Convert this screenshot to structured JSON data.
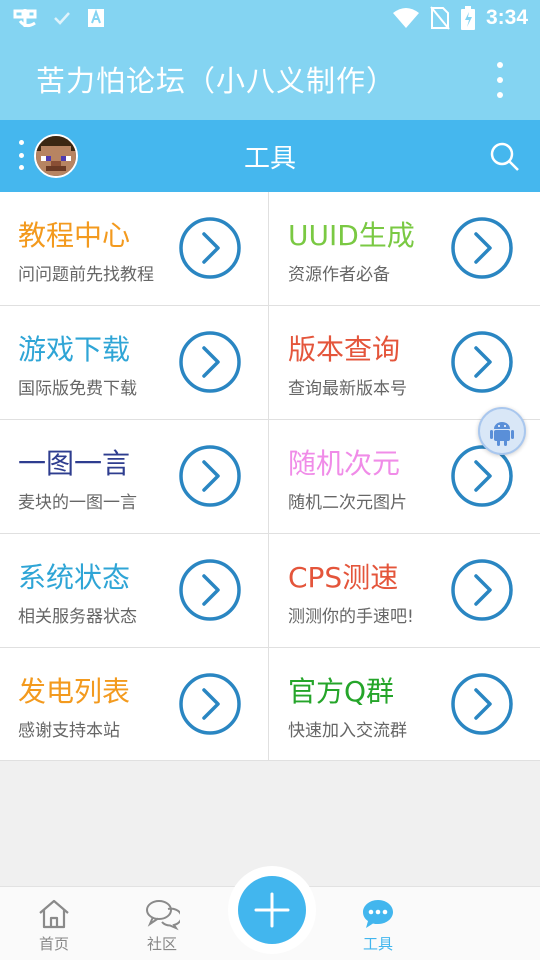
{
  "status_bar": {
    "time": "3:34",
    "icons": [
      "app-notification-icon",
      "check-icon",
      "text-icon",
      "wifi-icon",
      "no-sim-icon",
      "battery-charging-icon"
    ]
  },
  "app_bar": {
    "title": "苦力怕论坛（小八义制作）"
  },
  "tool_bar": {
    "title": "工具"
  },
  "tools": [
    {
      "title": "教程中心",
      "subtitle": "问问题前先找教程",
      "color": "#f39a1e"
    },
    {
      "title": "UUID生成",
      "subtitle": "资源作者必备",
      "color": "#7ac943"
    },
    {
      "title": "游戏下载",
      "subtitle": "国际版免费下载",
      "color": "#2fa5d6"
    },
    {
      "title": "版本查询",
      "subtitle": "查询最新版本号",
      "color": "#e4553b"
    },
    {
      "title": "一图一言",
      "subtitle": "麦块的一图一言",
      "color": "#2e3d8f"
    },
    {
      "title": "随机次元",
      "subtitle": "随机二次元图片",
      "color": "#f08ce8"
    },
    {
      "title": "系统状态",
      "subtitle": "相关服务器状态",
      "color": "#2fa5d6"
    },
    {
      "title": "CPS测速",
      "subtitle": "测测你的手速吧!",
      "color": "#e4553b"
    },
    {
      "title": "发电列表",
      "subtitle": "感谢支持本站",
      "color": "#f39a1e"
    },
    {
      "title": "官方Q群",
      "subtitle": "快速加入交流群",
      "color": "#25a52a"
    }
  ],
  "colors": {
    "accent": "#42b6ee",
    "go_circle": "#2a86c2",
    "nav_inactive": "#888888"
  },
  "bottom_nav": {
    "home": "首页",
    "community": "社区",
    "tools": "工具"
  }
}
